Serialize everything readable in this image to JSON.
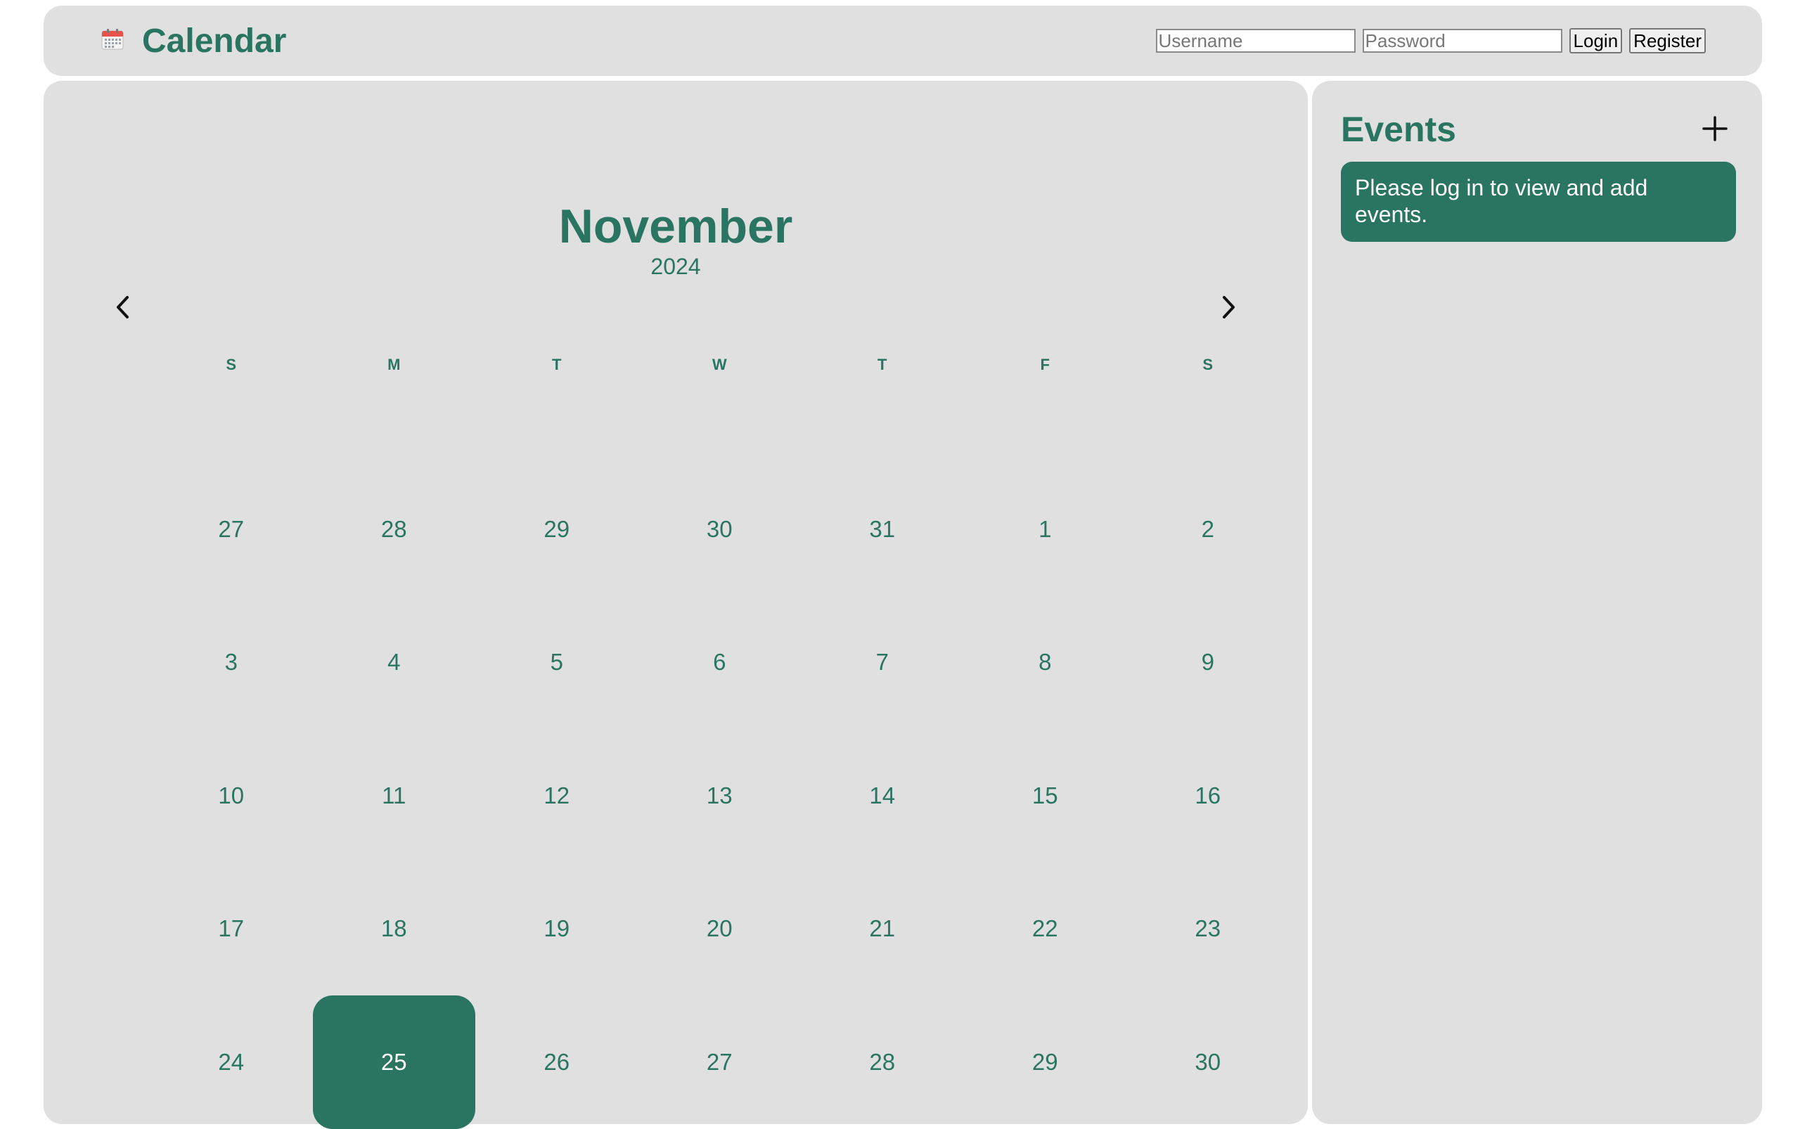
{
  "header": {
    "title": "Calendar",
    "icon": "calendar-icon",
    "username_placeholder": "Username",
    "password_placeholder": "Password",
    "login_label": "Login",
    "register_label": "Register"
  },
  "calendar": {
    "month": "November",
    "year": "2024",
    "prev_icon": "chevron-left-icon",
    "next_icon": "chevron-right-icon",
    "weekdays": [
      "S",
      "M",
      "T",
      "W",
      "T",
      "F",
      "S"
    ],
    "days": [
      "27",
      "28",
      "29",
      "30",
      "31",
      "1",
      "2",
      "3",
      "4",
      "5",
      "6",
      "7",
      "8",
      "9",
      "10",
      "11",
      "12",
      "13",
      "14",
      "15",
      "16",
      "17",
      "18",
      "19",
      "20",
      "21",
      "22",
      "23",
      "24",
      "25",
      "26",
      "27",
      "28",
      "29",
      "30"
    ],
    "selected_day": "25"
  },
  "events": {
    "title": "Events",
    "add_icon": "plus-icon",
    "message": "Please log in to view and add events."
  },
  "colors": {
    "accent": "#2a7561",
    "panel": "#e0e0e0"
  }
}
